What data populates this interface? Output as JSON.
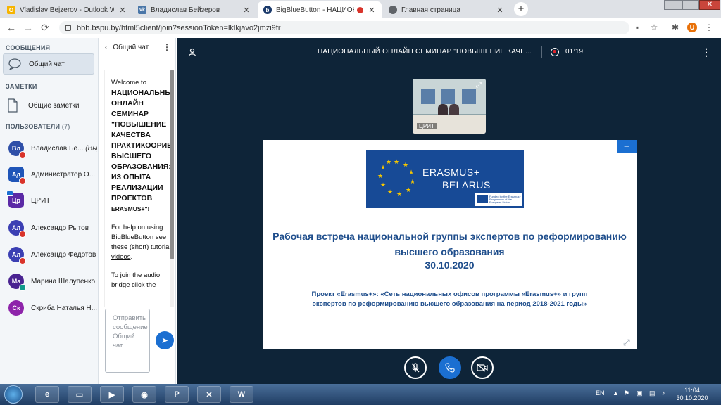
{
  "browser": {
    "tabs": [
      {
        "title": "Vladislav Bejzerov - Outlook Web",
        "fav_color": "#f6b400",
        "fav_glyph": "O"
      },
      {
        "title": "Владислав Бейзеров",
        "fav_color": "#4a76a8",
        "fav_glyph": "vk"
      },
      {
        "title": "BigBlueButton - НАЦИОНАЛ",
        "fav_color": "#1b3a6b",
        "fav_glyph": "b"
      },
      {
        "title": "Главная страница",
        "fav_color": "#5f6368",
        "fav_glyph": "◎"
      }
    ],
    "new_tab": "+",
    "url": "bbb.bspu.by/html5client/join?sessionToken=lklkjavo2jmzi9fr",
    "profile_initial": "U"
  },
  "sidebar": {
    "messages_heading": "СООБЩЕНИЯ",
    "public_chat": "Общий чат",
    "notes_heading": "ЗАМЕТКИ",
    "shared_notes": "Общие заметки",
    "users_heading": "ПОЛЬЗОВАТЕЛИ",
    "users_count": "(7)",
    "users": [
      {
        "initials": "Вл",
        "name": "Владислав Бе...",
        "you": "(Вы)",
        "color": "#2e4fa8",
        "mic": "#d9342b",
        "square": false,
        "presenter": false
      },
      {
        "initials": "Ад",
        "name": "Администратор О...",
        "you": "",
        "color": "#1f55b8",
        "mic": "#d9342b",
        "square": true,
        "presenter": false
      },
      {
        "initials": "Цр",
        "name": "ЦРИТ",
        "you": "",
        "color": "#5b2aa6",
        "mic": "",
        "square": true,
        "presenter": true
      },
      {
        "initials": "Ал",
        "name": "Александр Рытов",
        "you": "",
        "color": "#3b3fb3",
        "mic": "#d9342b",
        "square": false,
        "presenter": false
      },
      {
        "initials": "Ал",
        "name": "Александр Федотов",
        "you": "",
        "color": "#3b3fb3",
        "mic": "#d9342b",
        "square": false,
        "presenter": false
      },
      {
        "initials": "Ма",
        "name": "Марина Шалупенко",
        "you": "",
        "color": "#4a2391",
        "mic": "#12998a",
        "square": false,
        "presenter": false
      },
      {
        "initials": "Ск",
        "name": "Скриба Наталья Н...",
        "you": "",
        "color": "#8e24aa",
        "mic": "",
        "square": false,
        "presenter": false
      }
    ]
  },
  "chat": {
    "title": "Общий чат",
    "welcome": "Welcome to",
    "meeting_name": "НАЦИОНАЛЬНЫЙ ОНЛАЙН СЕМИНАР \"ПОВЫШЕНИЕ КАЧЕСТВА ПРАКТИКООРИЕНТИРОВАННОСТИ ВЫСШЕГО ОБРАЗОВАНИЯ: ИЗ ОПЫТА РЕАЛИЗАЦИИ ПРОЕКТОВ",
    "meeting_tail": "ERASMUS+\"!",
    "help_prefix": "For help on using BigBlueButton see these (short)",
    "help_link": "tutorial videos",
    "help_suffix": ".",
    "audio_text": "To join the audio bridge click the",
    "input_placeholder": "Отправить сообщение Общий чат"
  },
  "main": {
    "title": "НАЦИОНАЛЬНЫЙ ОНЛАЙН СЕМИНАР \"ПОВЫШЕНИЕ КАЧЕ...",
    "timer": "01:19",
    "webcam_label": "ЦРИТ"
  },
  "slide": {
    "logo_line1": "ERASMUS+",
    "logo_line2": "BELARUS",
    "eu_text": "Funded by the Erasmus+ Programme of the European Union",
    "title": "Рабочая встреча национальной группы экспертов по реформированию высшего образования",
    "date": "30.10.2020",
    "project": "Проект «Erasmus+»: «Сеть национальных офисов программы «Erasmus+» и групп экспертов по реформированию высшего образования на период 2018-2021 годы»"
  },
  "taskbar": {
    "lang": "EN",
    "time": "11:04",
    "date": "30.10.2020"
  }
}
